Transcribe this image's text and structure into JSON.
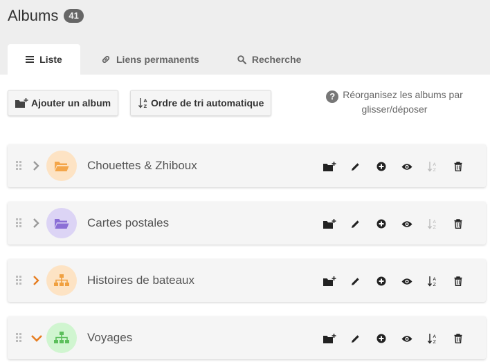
{
  "header": {
    "title": "Albums",
    "count": "41"
  },
  "tabs": [
    {
      "label": "Liste",
      "icon": "list-icon",
      "active": true
    },
    {
      "label": "Liens permanents",
      "icon": "link-icon",
      "active": false
    },
    {
      "label": "Recherche",
      "icon": "search-icon",
      "active": false
    }
  ],
  "toolbar": {
    "add_label": "Ajouter un album",
    "sort_label": "Ordre de tri automatique",
    "hint_text": "Réorganisez les albums par glisser/déposer",
    "hint_icon": "question-circle-icon"
  },
  "colors": {
    "orange": "#e67e22",
    "header_bg": "#eeeeee"
  },
  "albums": [
    {
      "name": "Chouettes & Zhiboux",
      "icon": "folder-open-icon",
      "expander": "chevron-right",
      "sort_enabled": false
    },
    {
      "name": "Cartes postales",
      "icon": "folder-open-icon",
      "expander": "chevron-right",
      "sort_enabled": false
    },
    {
      "name": "Histoires de bateaux",
      "icon": "sitemap-icon",
      "expander": "chevron-right",
      "sort_enabled": true
    },
    {
      "name": "Voyages",
      "icon": "sitemap-icon",
      "expander": "chevron-down",
      "sort_enabled": true
    }
  ]
}
